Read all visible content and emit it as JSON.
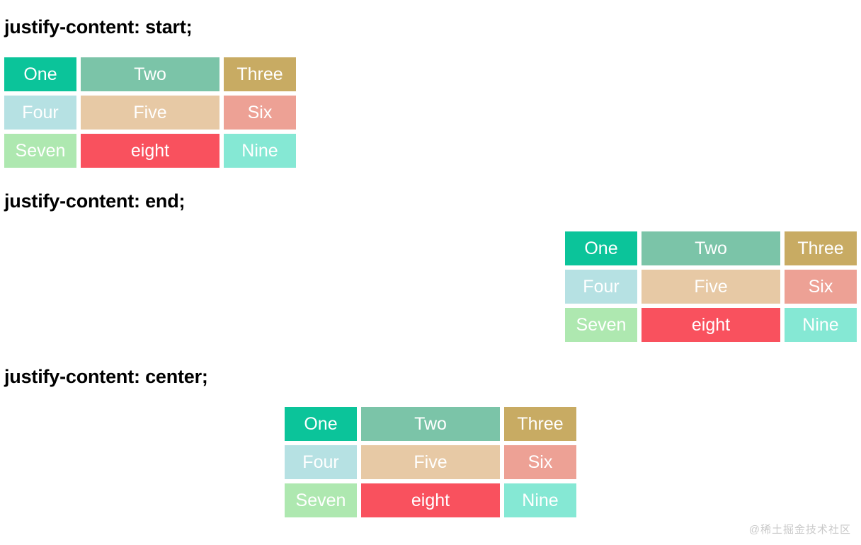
{
  "page": {
    "background_color": "#ffffff",
    "watermark": "@稀土掘金技术社区"
  },
  "items": [
    {
      "label": "One",
      "color": "#0bc49a",
      "width": "narrow"
    },
    {
      "label": "Two",
      "color": "#7bc4a8",
      "width": "wide"
    },
    {
      "label": "Three",
      "color": "#c8ab63",
      "width": "narrow"
    },
    {
      "label": "Four",
      "color": "#b6e1e3",
      "width": "narrow"
    },
    {
      "label": "Five",
      "color": "#e7c9a5",
      "width": "wide"
    },
    {
      "label": "Six",
      "color": "#eda195",
      "width": "narrow"
    },
    {
      "label": "Seven",
      "color": "#aee8b0",
      "width": "narrow"
    },
    {
      "label": "eight",
      "color": "#f9515e",
      "width": "wide"
    },
    {
      "label": "Nine",
      "color": "#85e8d4",
      "width": "narrow"
    }
  ],
  "sections": [
    {
      "id": "start",
      "heading": "justify-content: start;",
      "alignment": "start"
    },
    {
      "id": "end",
      "heading": "justify-content: end;",
      "alignment": "end"
    },
    {
      "id": "center",
      "heading": "justify-content: center;",
      "alignment": "center"
    }
  ]
}
